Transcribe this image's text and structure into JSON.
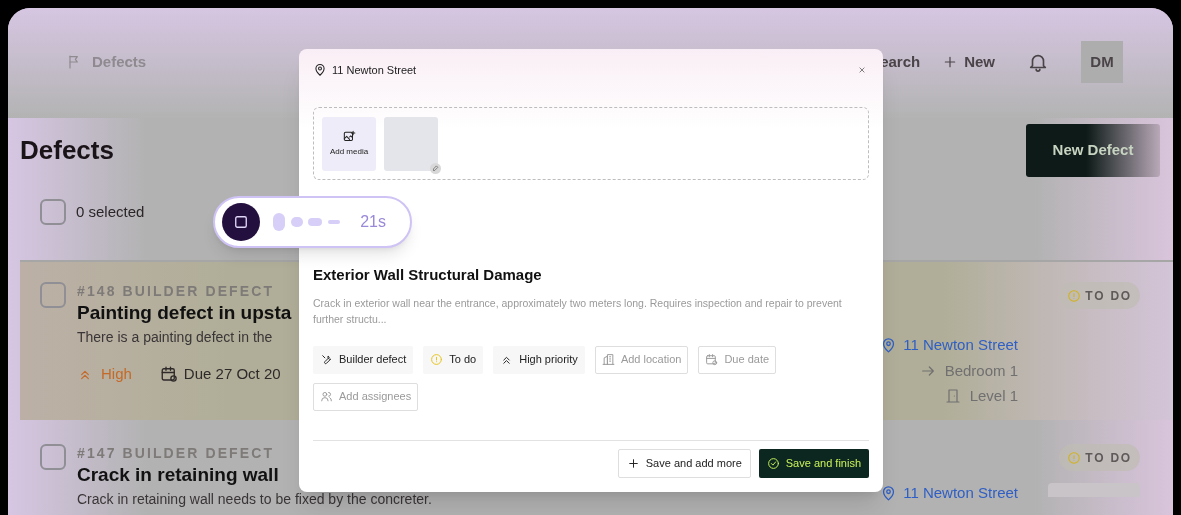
{
  "header": {
    "nav_label": "Defects",
    "search_label": "earch",
    "new_label": "New",
    "avatar": "DM"
  },
  "page": {
    "title": "Defects",
    "new_button": "New Defect",
    "selection": {
      "checked": false,
      "count": "0",
      "label": "selected"
    }
  },
  "defects": [
    {
      "ref": "#148 BUILDER DEFECT",
      "title": "Painting defect in upsta",
      "description": "There is a painting defect in the",
      "highlighted": true,
      "checked": false,
      "priority": "High",
      "due": "Due 27 Oct 20",
      "status": "TO DO",
      "location": "11 Newton Street",
      "room": "Bedroom 1",
      "level": "Level 1",
      "photo": false
    },
    {
      "ref": "#147 BUILDER DEFECT",
      "title": "Crack in retaining wall",
      "description": "Crack in retaining wall needs to be fixed by the concreter.",
      "highlighted": false,
      "checked": false,
      "status": "TO DO",
      "location": "11 Newton Street",
      "photo": true
    }
  ],
  "modal": {
    "location": "11 Newton Street",
    "add_media": "Add media",
    "title": "Exterior Wall Structural Damage",
    "description": "Crack in exterior wall near the entrance, approximately two meters long. Requires inspection and repair to prevent further structu...",
    "chips": [
      {
        "kind": "set",
        "label": "Builder defect"
      },
      {
        "kind": "set",
        "label": "To do"
      },
      {
        "kind": "set",
        "label": "High priority"
      },
      {
        "kind": "empty",
        "label": "Add location"
      },
      {
        "kind": "empty",
        "label": "Due date"
      },
      {
        "kind": "empty",
        "label": "Add assignees"
      }
    ],
    "buttons": [
      {
        "kind": "secondary",
        "label": "Save and add more"
      },
      {
        "kind": "primary",
        "label": "Save and finish"
      }
    ]
  },
  "recorder": {
    "time": "21s"
  }
}
